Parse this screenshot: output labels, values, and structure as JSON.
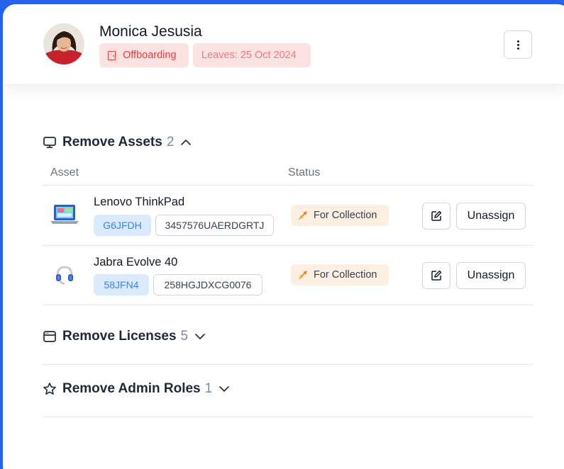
{
  "employee": {
    "name": "Monica Jesusia",
    "status_badge": "Offboarding",
    "leave_badge": "Leaves: 25 Oct 2024"
  },
  "sections": {
    "assets": {
      "title": "Remove Assets",
      "count": "2",
      "expanded": true,
      "columns": {
        "asset": "Asset",
        "status": "Status"
      },
      "rows": [
        {
          "name": "Lenovo ThinkPad",
          "icon": "laptop-icon",
          "tag": "G6JFDH",
          "serial": "3457576UAERDGRTJ",
          "status": "For Collection",
          "action": "Unassign"
        },
        {
          "name": "Jabra Evolve 40",
          "icon": "headset-icon",
          "tag": "58JFN4",
          "serial": "258HGJDXCG0076",
          "status": "For Collection",
          "action": "Unassign"
        }
      ]
    },
    "licenses": {
      "title": "Remove Licenses",
      "count": "5",
      "expanded": false
    },
    "admin_roles": {
      "title": "Remove Admin Roles",
      "count": "1",
      "expanded": false
    }
  },
  "colors": {
    "background": "#2563eb",
    "badge_bg": "#fde2e2",
    "badge_text": "#ea3e3e",
    "tag_bg": "#dbeafe",
    "tag_text": "#3b82f6",
    "status_bg": "#fdf0e2"
  }
}
